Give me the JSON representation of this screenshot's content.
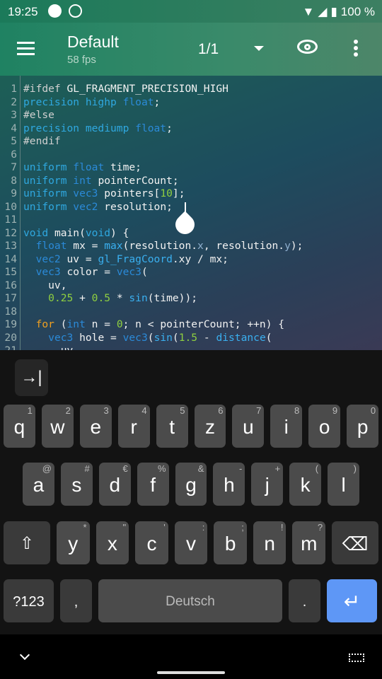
{
  "status": {
    "time": "19:25",
    "battery": "100 %"
  },
  "appbar": {
    "title": "Default",
    "fps": "58 fps",
    "page": "1/1"
  },
  "editor": {
    "lines": [
      [
        [
          "#ifdef ",
          "pp"
        ],
        [
          "GL_FRAGMENT_PRECISION_HIGH",
          ""
        ]
      ],
      [
        [
          "precision highp ",
          "kw"
        ],
        [
          "float",
          "ty"
        ],
        [
          ";",
          ""
        ]
      ],
      [
        [
          "#else",
          "pp"
        ]
      ],
      [
        [
          "precision mediump ",
          "kw"
        ],
        [
          "float",
          "ty"
        ],
        [
          ";",
          ""
        ]
      ],
      [
        [
          "#endif",
          "pp"
        ]
      ],
      [],
      [
        [
          "uniform ",
          "kw"
        ],
        [
          "float",
          "ty"
        ],
        [
          " time;",
          ""
        ]
      ],
      [
        [
          "uniform ",
          "kw"
        ],
        [
          "int",
          "ty"
        ],
        [
          " pointerCount;",
          ""
        ]
      ],
      [
        [
          "uniform ",
          "kw"
        ],
        [
          "vec3",
          "ty"
        ],
        [
          " pointers[",
          ""
        ],
        [
          "10",
          "num"
        ],
        [
          "];",
          ""
        ]
      ],
      [
        [
          "uniform ",
          "kw"
        ],
        [
          "vec2",
          "ty"
        ],
        [
          " resolution;",
          ""
        ]
      ],
      [],
      [
        [
          "void",
          "kw"
        ],
        [
          " main(",
          ""
        ],
        [
          "void",
          "kw"
        ],
        [
          ") {",
          ""
        ]
      ],
      [
        [
          "  ",
          ""
        ],
        [
          "float",
          "ty"
        ],
        [
          " mx = ",
          ""
        ],
        [
          "max",
          "fn"
        ],
        [
          "(resolution.",
          ""
        ],
        [
          "x",
          "sw"
        ],
        [
          ", resolution.",
          ""
        ],
        [
          "y",
          "sw"
        ],
        [
          ");",
          ""
        ]
      ],
      [
        [
          "  ",
          ""
        ],
        [
          "vec2",
          "ty"
        ],
        [
          " uv = ",
          ""
        ],
        [
          "gl_FragCoord",
          "fn"
        ],
        [
          ".xy / mx;",
          ""
        ]
      ],
      [
        [
          "  ",
          ""
        ],
        [
          "vec3",
          "ty"
        ],
        [
          " color = ",
          ""
        ],
        [
          "vec3",
          "ty"
        ],
        [
          "(",
          ""
        ]
      ],
      [
        [
          "    uv,",
          ""
        ]
      ],
      [
        [
          "    ",
          ""
        ],
        [
          "0.25",
          "num"
        ],
        [
          " + ",
          ""
        ],
        [
          "0.5",
          "num"
        ],
        [
          " * ",
          ""
        ],
        [
          "sin",
          "fn"
        ],
        [
          "(time));",
          ""
        ]
      ],
      [],
      [
        [
          "  ",
          ""
        ],
        [
          "for",
          "ctl"
        ],
        [
          " (",
          ""
        ],
        [
          "int",
          "ty"
        ],
        [
          " n = ",
          ""
        ],
        [
          "0",
          "num"
        ],
        [
          "; n < pointerCount; ++n) {",
          ""
        ]
      ],
      [
        [
          "    ",
          ""
        ],
        [
          "vec3",
          "ty"
        ],
        [
          " hole = ",
          ""
        ],
        [
          "vec3",
          "ty"
        ],
        [
          "(",
          ""
        ],
        [
          "sin",
          "fn"
        ],
        [
          "(",
          ""
        ],
        [
          "1.5",
          "num"
        ],
        [
          " - ",
          ""
        ],
        [
          "distance",
          "fn"
        ],
        [
          "(",
          ""
        ]
      ],
      [
        [
          "      uv,",
          ""
        ]
      ]
    ]
  },
  "keyboard": {
    "tab_key": "→|",
    "row1": [
      [
        "q",
        "1"
      ],
      [
        "w",
        "2"
      ],
      [
        "e",
        "3"
      ],
      [
        "r",
        "4"
      ],
      [
        "t",
        "5"
      ],
      [
        "z",
        "6"
      ],
      [
        "u",
        "7"
      ],
      [
        "i",
        "8"
      ],
      [
        "o",
        "9"
      ],
      [
        "p",
        "0"
      ]
    ],
    "row2": [
      [
        "a",
        "@"
      ],
      [
        "s",
        "#"
      ],
      [
        "d",
        "€"
      ],
      [
        "f",
        "%"
      ],
      [
        "g",
        "&"
      ],
      [
        "h",
        "-"
      ],
      [
        "j",
        "+"
      ],
      [
        "k",
        "("
      ],
      [
        "l",
        ")"
      ]
    ],
    "row3": [
      [
        "y",
        "*"
      ],
      [
        "x",
        "\""
      ],
      [
        "c",
        "'"
      ],
      [
        "v",
        ":"
      ],
      [
        "b",
        ";"
      ],
      [
        "n",
        "!"
      ],
      [
        "m",
        "?"
      ]
    ],
    "shift": "⇧",
    "backspace": "⌫",
    "symbols": "?123",
    "comma": ",",
    "space": "Deutsch",
    "period": ".",
    "enter": "↵"
  },
  "colors": {
    "accent": "#1f8262",
    "enter": "#5e97f6"
  }
}
